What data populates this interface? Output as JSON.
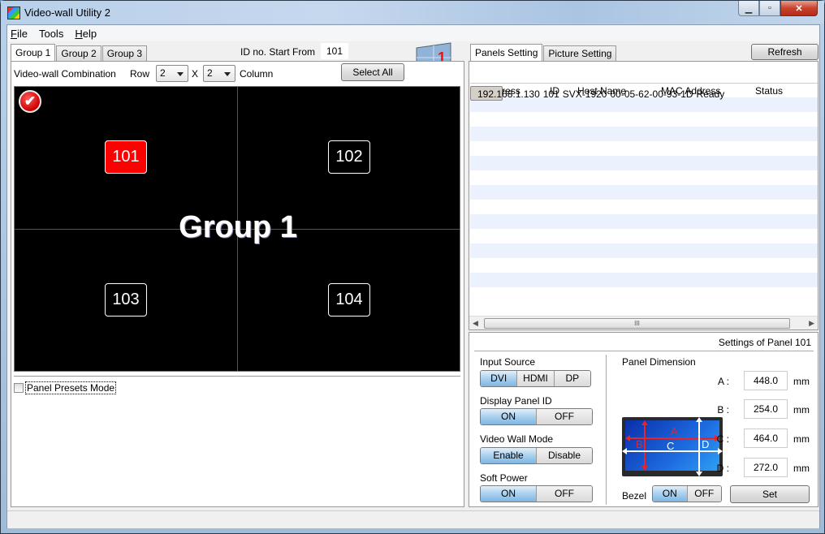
{
  "window": {
    "title": "Video-wall Utility 2"
  },
  "menu": [
    {
      "label": "File",
      "accel": "F"
    },
    {
      "label": "Tools",
      "accel": ""
    },
    {
      "label": "Help",
      "accel": "H"
    }
  ],
  "left": {
    "tabs": [
      {
        "label": "Group 1",
        "active": true
      },
      {
        "label": "Group 2",
        "active": false
      },
      {
        "label": "Group 3",
        "active": false
      }
    ],
    "id_start_label": "ID no. Start From",
    "id_start_value": "101",
    "combo_label": "Video-wall Combination",
    "row_label": "Row",
    "row_value": "2",
    "x_label": "X",
    "col_value": "2",
    "col_label": "Column",
    "select_all": "Select All",
    "group_label": "Group 1",
    "panels": [
      {
        "id": "101",
        "selected": true
      },
      {
        "id": "102",
        "selected": false
      },
      {
        "id": "103",
        "selected": false
      },
      {
        "id": "104",
        "selected": false
      }
    ],
    "presets_label": "Panel Presets Mode",
    "presets_checked": false
  },
  "right": {
    "tabs": [
      {
        "label": "Panels Setting",
        "active": true
      },
      {
        "label": "Picture Setting",
        "active": false
      }
    ],
    "refresh": "Refresh",
    "table": {
      "columns": [
        "IP Address",
        "ID",
        "Host Name",
        "MAC Address",
        "Status"
      ],
      "rows": [
        [
          "192.168.1.130",
          "101",
          "SVX-1920",
          "00-05-62-00-93-1D",
          "Ready"
        ]
      ]
    },
    "scroll_grip": "III",
    "settings_title": "Settings of Panel 101",
    "input_source": {
      "label": "Input Source",
      "options": [
        "DVI",
        "HDMI",
        "DP"
      ],
      "selected": "DVI"
    },
    "display_panel_id": {
      "label": "Display Panel ID",
      "options": [
        "ON",
        "OFF"
      ],
      "selected": "ON"
    },
    "video_wall_mode": {
      "label": "Video Wall Mode",
      "options": [
        "Enable",
        "Disable"
      ],
      "selected": "Enable"
    },
    "soft_power": {
      "label": "Soft Power",
      "options": [
        "ON",
        "OFF"
      ],
      "selected": "ON"
    },
    "panel_dimension": {
      "label": "Panel Dimension",
      "unit": "mm",
      "fields": [
        {
          "name": "A :",
          "value": "448.0"
        },
        {
          "name": "B :",
          "value": "254.0"
        },
        {
          "name": "C :",
          "value": "464.0"
        },
        {
          "name": "D :",
          "value": "272.0"
        }
      ],
      "diagram_labels": [
        "A",
        "B",
        "C",
        "D"
      ]
    },
    "bezel": {
      "label": "Bezel",
      "options": [
        "ON",
        "OFF"
      ],
      "selected": "ON"
    },
    "set": "Set"
  },
  "colors": {
    "selected_panel": "#ff0000",
    "toggle_on": "#8fc2ea",
    "grid_selected_row": "#d4d0c8",
    "grid_alt_row": "#ebf1fd"
  }
}
